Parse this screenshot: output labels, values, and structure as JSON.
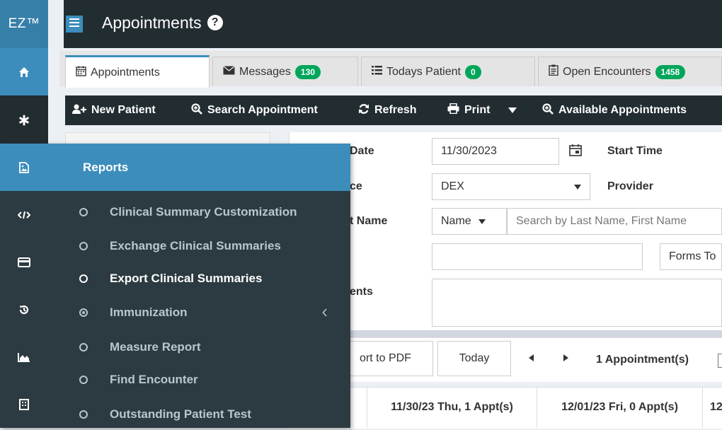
{
  "brand": "EZ™",
  "header": {
    "title": "Appointments",
    "help_glyph": "?"
  },
  "tabs": [
    {
      "label": "Appointments",
      "icon": "calendar-icon"
    },
    {
      "label": "Messages",
      "badge": "130",
      "icon": "envelope-icon"
    },
    {
      "label": "Todays Patient",
      "badge": "0",
      "icon": "list-icon"
    },
    {
      "label": "Open Encounters",
      "badge": "1458",
      "icon": "clipboard-icon"
    }
  ],
  "toolbar": {
    "new_patient": "New Patient",
    "search_appointment": "Search Appointment",
    "refresh": "Refresh",
    "print": "Print",
    "available_appointments": "Available Appointments"
  },
  "form": {
    "date_label": "Date",
    "date_value": "11/30/2023",
    "start_time_label": "Start Time",
    "office_label": "ce",
    "office_value": "DEX",
    "provider_label": "Provider",
    "name_label": "t Name",
    "name_select": "Name",
    "name_placeholder": "Search by Last Name, First Name",
    "forms_label": "Forms To",
    "comments_label": "ents"
  },
  "calendar": {
    "export_pdf": "ort to PDF",
    "today": "Today",
    "count": "1 Appointment(s)",
    "col_1": "11/30/23 Thu, 1 Appt(s)",
    "col_2": "12/01/23 Fri, 0 Appt(s)",
    "col_3": "12"
  },
  "reports_menu": {
    "title": "Reports",
    "items": [
      "Clinical Summary Customization",
      "Exchange Clinical Summaries",
      "Export Clinical Summaries",
      "Immunization",
      "Measure Report",
      "Find Encounter",
      "Outstanding Patient Test"
    ],
    "active_item": "Export Clinical Summaries"
  },
  "colors": {
    "sidebar": "#222d32",
    "accent": "#3c8dbc",
    "badge": "#00a65a",
    "flyout": "#2c3b41"
  }
}
